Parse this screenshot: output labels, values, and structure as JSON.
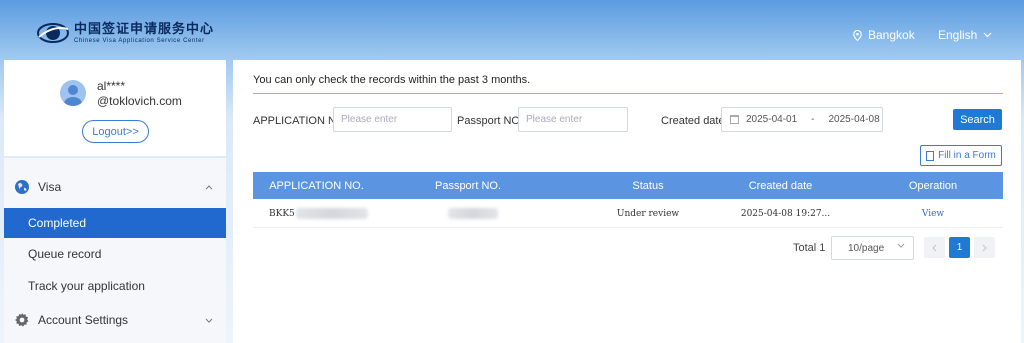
{
  "header": {
    "logo_cn": "中国签证申请服务中心",
    "logo_en": "Chinese Visa Application Service Center",
    "location": "Bangkok",
    "language": "English"
  },
  "user": {
    "name": "al****",
    "email": "@toklovich.com",
    "logout_label": "Logout>>"
  },
  "sidebar": {
    "visa_label": "Visa",
    "items": [
      {
        "label": "Completed",
        "active": true
      },
      {
        "label": "Queue record",
        "active": false
      },
      {
        "label": "Track your application",
        "active": false
      }
    ],
    "account_label": "Account Settings"
  },
  "main": {
    "notice": "You can only check the records within the past 3 months.",
    "filters": {
      "app_no_label": "APPLICATION NO.",
      "app_no_placeholder": "Please enter",
      "passport_label": "Passport NO.",
      "passport_placeholder": "Please enter",
      "created_label": "Created date",
      "date_from": "2025-04-01",
      "date_sep": "-",
      "date_to": "2025-04-08",
      "search_label": "Search"
    },
    "fill_form_label": "Fill in a Form",
    "table": {
      "columns": [
        "APPLICATION NO.",
        "Passport NO.",
        "Status",
        "Created date",
        "Operation"
      ],
      "rows": [
        {
          "app_no": "BKK5",
          "passport": "",
          "status": "Under review",
          "created": "2025-04-08 19:27...",
          "operation": "View"
        }
      ]
    },
    "pagination": {
      "total": "Total 1",
      "page_size": "10/page",
      "current": "1"
    }
  },
  "colors": {
    "accent": "#1f7ad4",
    "table_header": "#5b95e2",
    "active_menu": "#2168cf"
  }
}
